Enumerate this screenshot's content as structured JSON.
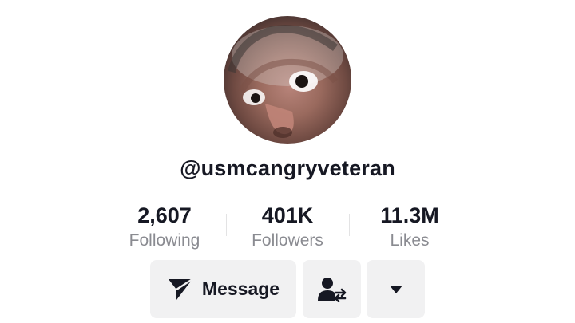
{
  "profile": {
    "avatar_icon": "profile-photo",
    "username": "@usmcangryveteran"
  },
  "stats": [
    {
      "value": "2,607",
      "label": "Following"
    },
    {
      "value": "401K",
      "label": "Followers"
    },
    {
      "value": "11.3M",
      "label": "Likes"
    }
  ],
  "actions": {
    "message_label": "Message",
    "message_icon": "send-icon",
    "friends_icon": "user-swap-icon",
    "more_icon": "caret-down-icon"
  },
  "colors": {
    "text": "#161823",
    "muted": "#8a8b91",
    "button_bg": "#f1f1f2"
  }
}
